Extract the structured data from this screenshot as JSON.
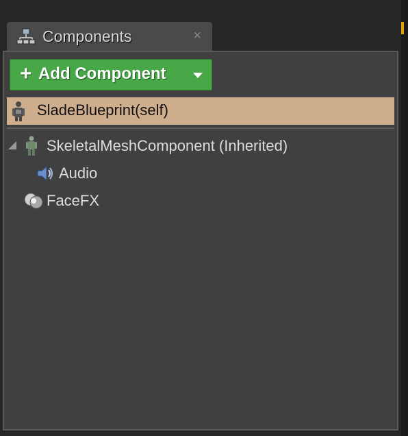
{
  "tab": {
    "title": "Components",
    "icon": "components-icon",
    "close_label": "×",
    "close_icon": "close-icon"
  },
  "toolbar": {
    "add_plus": "+",
    "add_label": "Add Component",
    "add_caret_icon": "caret-down-icon",
    "button_color": "#48a848"
  },
  "tree": {
    "self_row": {
      "label": "SladeBlueprint(self)",
      "icon": "blueprint-actor-icon",
      "highlight_color": "#cfae8e"
    },
    "items": [
      {
        "label": "SkeletalMeshComponent (Inherited)",
        "icon": "skeletal-mesh-icon",
        "expanded": true,
        "children": [
          {
            "label": "Audio",
            "icon": "audio-icon"
          }
        ]
      },
      {
        "label": "FaceFX",
        "icon": "facefx-icon"
      }
    ]
  },
  "colors": {
    "panel_bg": "#404040",
    "tab_bg": "#4a4a4a",
    "text": "#dcdcdc",
    "accent_right": "#e0a000"
  }
}
